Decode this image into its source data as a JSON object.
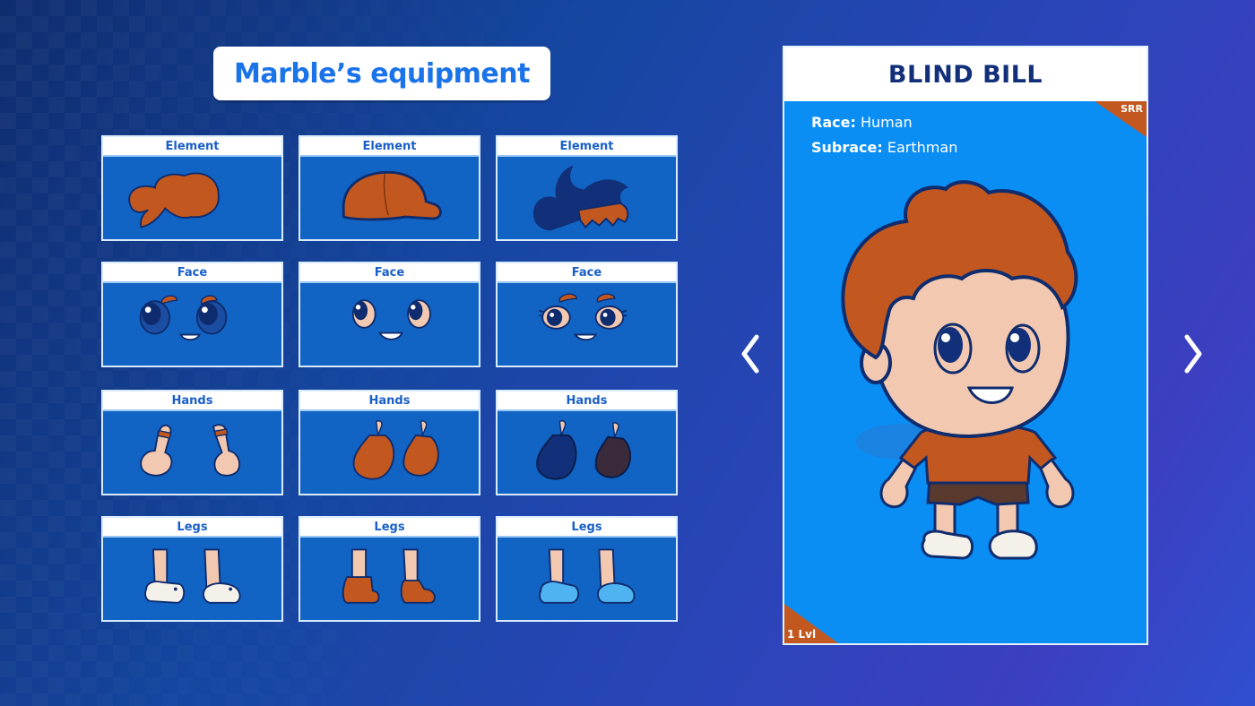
{
  "title": "Marble’s equipment",
  "equipment": [
    {
      "category": "Element",
      "item": "hair-orange-tuft-icon"
    },
    {
      "category": "Element",
      "item": "cap-orange-icon"
    },
    {
      "category": "Element",
      "item": "hat-navy-orange-icon"
    },
    {
      "category": "Face",
      "item": "face-eyes-brows-icon"
    },
    {
      "category": "Face",
      "item": "face-plain-icon"
    },
    {
      "category": "Face",
      "item": "face-lashes-brows-icon"
    },
    {
      "category": "Hands",
      "item": "hands-bare-icon"
    },
    {
      "category": "Hands",
      "item": "hands-orange-gloves-icon"
    },
    {
      "category": "Hands",
      "item": "hands-navy-gloves-icon"
    },
    {
      "category": "Legs",
      "item": "legs-white-slippers-icon"
    },
    {
      "category": "Legs",
      "item": "legs-orange-boots-icon"
    },
    {
      "category": "Legs",
      "item": "legs-blue-slippers-icon"
    }
  ],
  "character": {
    "name": "BLIND BILL",
    "rarity": "SRR",
    "race_label": "Race:",
    "race": "Human",
    "subrace_label": "Subrace:",
    "subrace": "Earthman",
    "level": "1 Lvl"
  },
  "colors": {
    "accent": "#1a73e8",
    "card_bg": "#1264c4",
    "hero_bg": "#0a8ef3",
    "rarity": "#c2581f",
    "hair": "#c2581f",
    "navy": "#12307a"
  },
  "icons": {
    "prev": "chevron-left-icon",
    "next": "chevron-right-icon"
  }
}
